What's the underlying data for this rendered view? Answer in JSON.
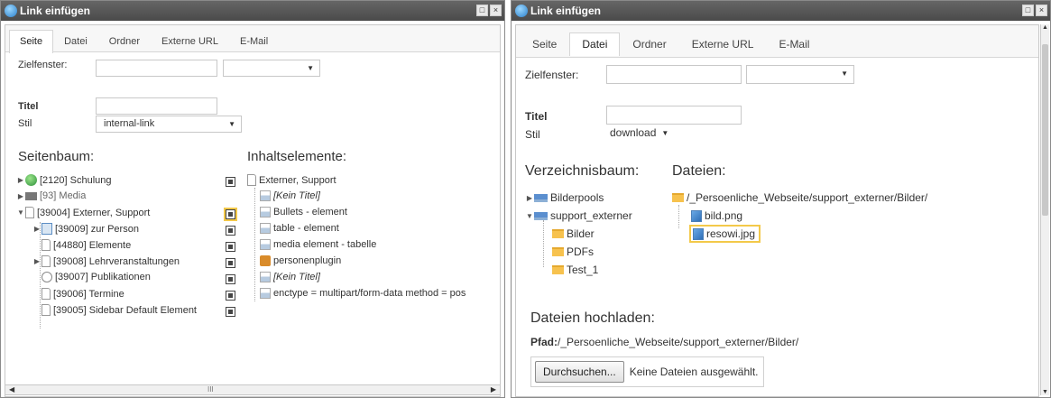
{
  "dialog1": {
    "title": "Link einfügen",
    "tabs": [
      "Seite",
      "Datei",
      "Ordner",
      "Externe URL",
      "E-Mail"
    ],
    "zielfenster_label": "Zielfenster:",
    "titel_label": "Titel",
    "stil_label": "Stil",
    "stil_value": "internal-link",
    "seitenbaum_header": "Seitenbaum:",
    "inhalt_header": "Inhaltselemente:",
    "pages": [
      {
        "label": "[2120] Schulung"
      },
      {
        "label": "[93] Media"
      },
      {
        "label": "[39004] Externer, Support"
      },
      {
        "label": "[39009] zur Person"
      },
      {
        "label": "[44880] Elemente"
      },
      {
        "label": "[39008] Lehrveranstaltungen"
      },
      {
        "label": "[39007] Publikationen"
      },
      {
        "label": "[39006] Termine"
      },
      {
        "label": "[39005] Sidebar Default Element"
      }
    ],
    "content_root": "Externer, Support",
    "content_items": [
      "[Kein Titel]",
      "Bullets - element",
      "table - element",
      "media element - tabelle",
      "personenplugin",
      "[Kein Titel]",
      "enctype = multipart/form-data method = pos"
    ],
    "scroll_grip": "III"
  },
  "dialog2": {
    "title": "Link einfügen",
    "tabs": [
      "Seite",
      "Datei",
      "Ordner",
      "Externe URL",
      "E-Mail"
    ],
    "zielfenster_label": "Zielfenster:",
    "titel_label": "Titel",
    "stil_label": "Stil",
    "stil_value": "download",
    "verzeichnis_header": "Verzeichnisbaum:",
    "dateien_header": "Dateien:",
    "dirs": [
      "Bilderpools",
      "support_externer",
      "Bilder",
      "PDFs",
      "Test_1"
    ],
    "path": "/_Persoenliche_Webseite/support_externer/Bilder/",
    "files": [
      "bild.png",
      "resowi.jpg"
    ],
    "upload_header": "Dateien hochladen:",
    "pfad_label": "Pfad:",
    "pfad_value": "/_Persoenliche_Webseite/support_externer/Bilder/",
    "browse_button": "Durchsuchen...",
    "no_file": "Keine Dateien ausgewählt."
  }
}
